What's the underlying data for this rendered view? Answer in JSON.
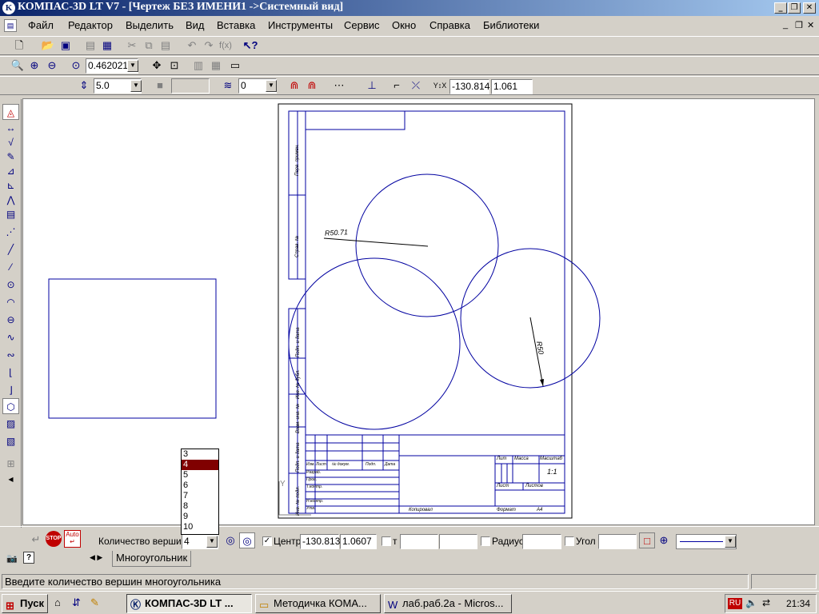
{
  "window": {
    "title": "КОМПАС-3D LT V7 - [Чертеж БЕЗ ИМЕНИ1 ->Системный вид]",
    "minimize": "_",
    "maximize": "❐",
    "close": "✕"
  },
  "menu": {
    "items": [
      "Файл",
      "Редактор",
      "Выделить",
      "Вид",
      "Вставка",
      "Инструменты",
      "Сервис",
      "Окно",
      "Справка",
      "Библиотеки"
    ],
    "doc_min": "_",
    "doc_restore": "❐",
    "doc_close": "✕"
  },
  "toolbar_zoom": {
    "zoom_value": "0.462021"
  },
  "toolbar_current": {
    "step_value": "5.0",
    "layer_value": "0",
    "x_coord": "-130.814",
    "y_coord": "1.061"
  },
  "drawing": {
    "radius_label_1": "R50.71",
    "radius_label_2": "R50",
    "title_block": {
      "lit": "Лит",
      "massa": "Масса",
      "masshtab": "Масштаб",
      "scale": "1:1",
      "list": "Лист",
      "listov": "Листов",
      "kopiroval": "Копировал",
      "format": "Формат",
      "format_value": "A4",
      "izm": "Изм.",
      "list_small": "Лист",
      "ndokum": "№ докум.",
      "podp": "Подп.",
      "data": "Дата",
      "razrab": "Разраб.",
      "prov": "Пров.",
      "tkontr": "Т.контр.",
      "nkontr": "Н.контр.",
      "utv": "Утв."
    },
    "side_labels": [
      "Перв. примен.",
      "Справ. №",
      "Подп. и дата",
      "Инв. № дубл.",
      "Взам. инв. №",
      "Подп. и дата",
      "Инв. № подл."
    ]
  },
  "dropdown": {
    "options": [
      "3",
      "4",
      "5",
      "6",
      "7",
      "8",
      "9",
      "10"
    ],
    "selected": "4"
  },
  "properties": {
    "vertices_label": "Количество вершин",
    "vertices_value": "4",
    "center_label": "Центр",
    "center_x": "-130.813",
    "center_y": "1.0607",
    "t_label": "т",
    "radius_label": "Радиус",
    "angle_label": "Угол",
    "stop_label": "STOP",
    "auto_label": "Auto",
    "tab_label": "Многоугольник"
  },
  "status": {
    "text": "Введите количество вершин многоугольника"
  },
  "taskbar": {
    "start_label": "Пуск",
    "tasks": [
      "КОМПАС-3D LT ...",
      "Методичка КОМА...",
      "лаб.раб.2а - Micros..."
    ],
    "lang": "RU",
    "clock": "21:34"
  }
}
